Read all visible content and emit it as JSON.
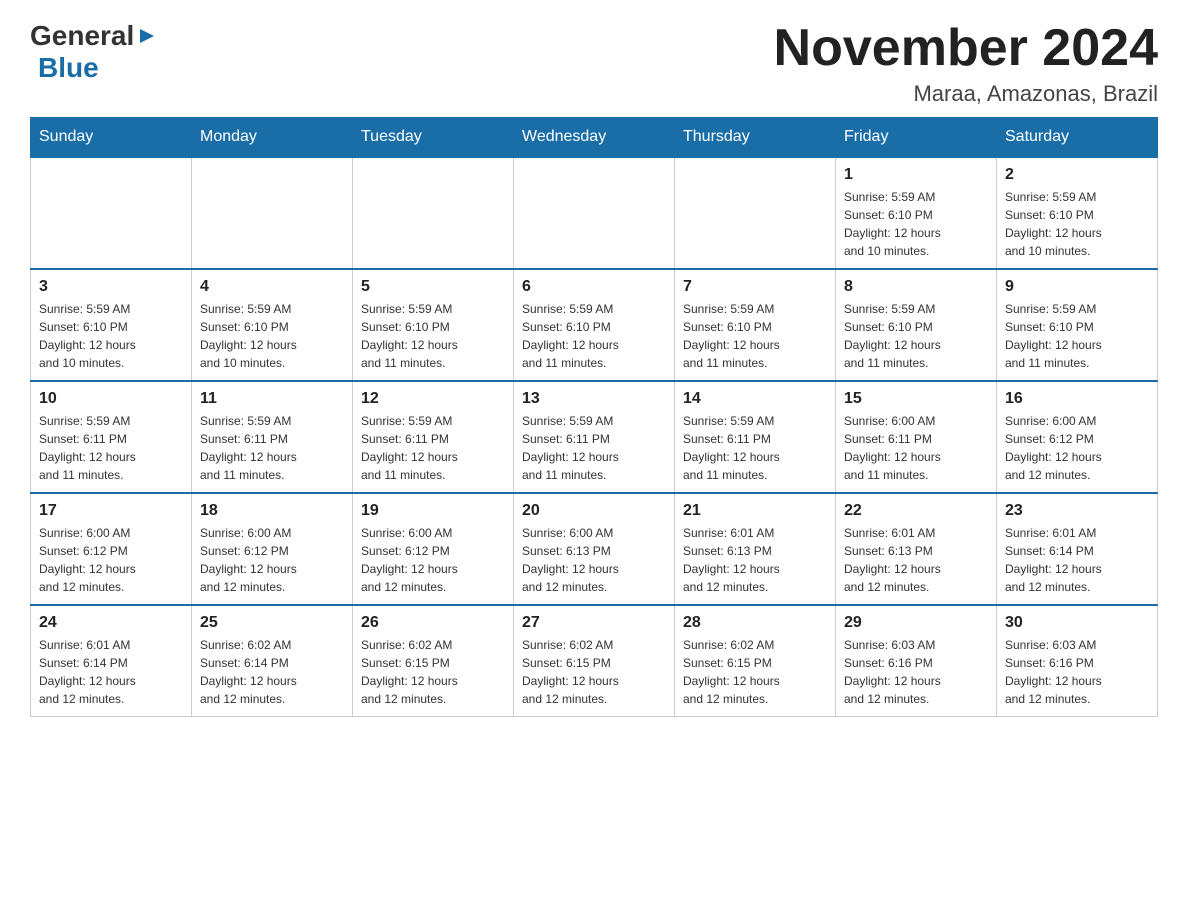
{
  "header": {
    "logo_general": "General",
    "logo_blue": "Blue",
    "title": "November 2024",
    "subtitle": "Maraa, Amazonas, Brazil"
  },
  "weekdays": [
    "Sunday",
    "Monday",
    "Tuesday",
    "Wednesday",
    "Thursday",
    "Friday",
    "Saturday"
  ],
  "weeks": [
    [
      {
        "day": "",
        "info": ""
      },
      {
        "day": "",
        "info": ""
      },
      {
        "day": "",
        "info": ""
      },
      {
        "day": "",
        "info": ""
      },
      {
        "day": "",
        "info": ""
      },
      {
        "day": "1",
        "info": "Sunrise: 5:59 AM\nSunset: 6:10 PM\nDaylight: 12 hours\nand 10 minutes."
      },
      {
        "day": "2",
        "info": "Sunrise: 5:59 AM\nSunset: 6:10 PM\nDaylight: 12 hours\nand 10 minutes."
      }
    ],
    [
      {
        "day": "3",
        "info": "Sunrise: 5:59 AM\nSunset: 6:10 PM\nDaylight: 12 hours\nand 10 minutes."
      },
      {
        "day": "4",
        "info": "Sunrise: 5:59 AM\nSunset: 6:10 PM\nDaylight: 12 hours\nand 10 minutes."
      },
      {
        "day": "5",
        "info": "Sunrise: 5:59 AM\nSunset: 6:10 PM\nDaylight: 12 hours\nand 11 minutes."
      },
      {
        "day": "6",
        "info": "Sunrise: 5:59 AM\nSunset: 6:10 PM\nDaylight: 12 hours\nand 11 minutes."
      },
      {
        "day": "7",
        "info": "Sunrise: 5:59 AM\nSunset: 6:10 PM\nDaylight: 12 hours\nand 11 minutes."
      },
      {
        "day": "8",
        "info": "Sunrise: 5:59 AM\nSunset: 6:10 PM\nDaylight: 12 hours\nand 11 minutes."
      },
      {
        "day": "9",
        "info": "Sunrise: 5:59 AM\nSunset: 6:10 PM\nDaylight: 12 hours\nand 11 minutes."
      }
    ],
    [
      {
        "day": "10",
        "info": "Sunrise: 5:59 AM\nSunset: 6:11 PM\nDaylight: 12 hours\nand 11 minutes."
      },
      {
        "day": "11",
        "info": "Sunrise: 5:59 AM\nSunset: 6:11 PM\nDaylight: 12 hours\nand 11 minutes."
      },
      {
        "day": "12",
        "info": "Sunrise: 5:59 AM\nSunset: 6:11 PM\nDaylight: 12 hours\nand 11 minutes."
      },
      {
        "day": "13",
        "info": "Sunrise: 5:59 AM\nSunset: 6:11 PM\nDaylight: 12 hours\nand 11 minutes."
      },
      {
        "day": "14",
        "info": "Sunrise: 5:59 AM\nSunset: 6:11 PM\nDaylight: 12 hours\nand 11 minutes."
      },
      {
        "day": "15",
        "info": "Sunrise: 6:00 AM\nSunset: 6:11 PM\nDaylight: 12 hours\nand 11 minutes."
      },
      {
        "day": "16",
        "info": "Sunrise: 6:00 AM\nSunset: 6:12 PM\nDaylight: 12 hours\nand 12 minutes."
      }
    ],
    [
      {
        "day": "17",
        "info": "Sunrise: 6:00 AM\nSunset: 6:12 PM\nDaylight: 12 hours\nand 12 minutes."
      },
      {
        "day": "18",
        "info": "Sunrise: 6:00 AM\nSunset: 6:12 PM\nDaylight: 12 hours\nand 12 minutes."
      },
      {
        "day": "19",
        "info": "Sunrise: 6:00 AM\nSunset: 6:12 PM\nDaylight: 12 hours\nand 12 minutes."
      },
      {
        "day": "20",
        "info": "Sunrise: 6:00 AM\nSunset: 6:13 PM\nDaylight: 12 hours\nand 12 minutes."
      },
      {
        "day": "21",
        "info": "Sunrise: 6:01 AM\nSunset: 6:13 PM\nDaylight: 12 hours\nand 12 minutes."
      },
      {
        "day": "22",
        "info": "Sunrise: 6:01 AM\nSunset: 6:13 PM\nDaylight: 12 hours\nand 12 minutes."
      },
      {
        "day": "23",
        "info": "Sunrise: 6:01 AM\nSunset: 6:14 PM\nDaylight: 12 hours\nand 12 minutes."
      }
    ],
    [
      {
        "day": "24",
        "info": "Sunrise: 6:01 AM\nSunset: 6:14 PM\nDaylight: 12 hours\nand 12 minutes."
      },
      {
        "day": "25",
        "info": "Sunrise: 6:02 AM\nSunset: 6:14 PM\nDaylight: 12 hours\nand 12 minutes."
      },
      {
        "day": "26",
        "info": "Sunrise: 6:02 AM\nSunset: 6:15 PM\nDaylight: 12 hours\nand 12 minutes."
      },
      {
        "day": "27",
        "info": "Sunrise: 6:02 AM\nSunset: 6:15 PM\nDaylight: 12 hours\nand 12 minutes."
      },
      {
        "day": "28",
        "info": "Sunrise: 6:02 AM\nSunset: 6:15 PM\nDaylight: 12 hours\nand 12 minutes."
      },
      {
        "day": "29",
        "info": "Sunrise: 6:03 AM\nSunset: 6:16 PM\nDaylight: 12 hours\nand 12 minutes."
      },
      {
        "day": "30",
        "info": "Sunrise: 6:03 AM\nSunset: 6:16 PM\nDaylight: 12 hours\nand 12 minutes."
      }
    ]
  ]
}
